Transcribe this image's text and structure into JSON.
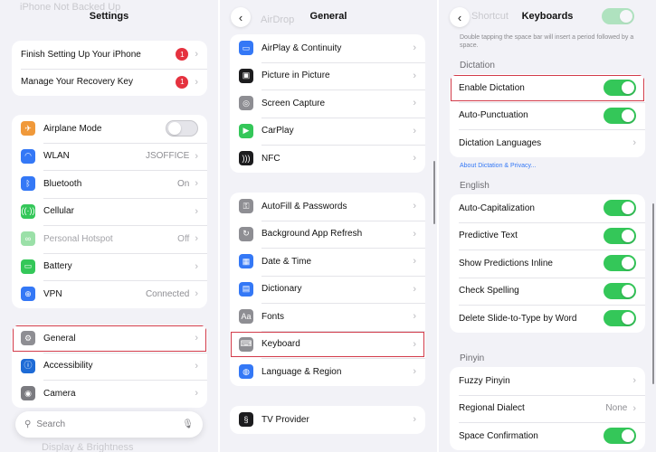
{
  "colors": {
    "accent": "#3478f6",
    "toggle_on": "#34c759",
    "badge": "#e5323f",
    "highlight": "#d23b4a"
  },
  "settings": {
    "title": "Settings",
    "ghost_top": "iPhone Not Backed Up",
    "account": [
      {
        "label": "Finish Setting Up Your iPhone",
        "badge": "1"
      },
      {
        "label": "Manage Your Recovery Key",
        "badge": "1"
      }
    ],
    "network": [
      {
        "label": "Airplane Mode",
        "icon": "airplane-icon",
        "color": "#f0993a",
        "toggle": "off"
      },
      {
        "label": "WLAN",
        "value": "JSOFFICE",
        "icon": "wifi-icon",
        "color": "#3478f6"
      },
      {
        "label": "Bluetooth",
        "value": "On",
        "icon": "bluetooth-icon",
        "color": "#3478f6"
      },
      {
        "label": "Cellular",
        "icon": "cellular-icon",
        "color": "#34c759"
      },
      {
        "label": "Personal Hotspot",
        "value": "Off",
        "icon": "hotspot-icon",
        "color": "#9be0a8",
        "dim": true
      },
      {
        "label": "Battery",
        "icon": "battery-icon",
        "color": "#34c759"
      },
      {
        "label": "VPN",
        "value": "Connected",
        "icon": "vpn-icon",
        "color": "#3478f6"
      }
    ],
    "general": [
      {
        "label": "General",
        "icon": "gear-icon",
        "color": "#8e8e93"
      },
      {
        "label": "Accessibility",
        "icon": "accessibility-icon",
        "color": "#1e6bd6"
      },
      {
        "label": "Camera",
        "icon": "camera-icon",
        "color": "#7b7b80"
      }
    ],
    "ghost_bottom": "Display & Brightness",
    "search_placeholder": "Search"
  },
  "general": {
    "title": "General",
    "ghost_top": "AirDrop",
    "group1": [
      {
        "label": "AirPlay & Continuity",
        "icon": "airplay-icon",
        "color": "#3478f6"
      },
      {
        "label": "Picture in Picture",
        "icon": "pip-icon",
        "color": "#1c1c1e"
      },
      {
        "label": "Screen Capture",
        "icon": "screen-capture-icon",
        "color": "#8e8e93"
      },
      {
        "label": "CarPlay",
        "icon": "carplay-icon",
        "color": "#34c759"
      },
      {
        "label": "NFC",
        "icon": "nfc-icon",
        "color": "#1c1c1e"
      }
    ],
    "group2": [
      {
        "label": "AutoFill & Passwords",
        "icon": "key-icon",
        "color": "#8e8e93"
      },
      {
        "label": "Background App Refresh",
        "icon": "refresh-icon",
        "color": "#8e8e93"
      },
      {
        "label": "Date & Time",
        "icon": "calendar-icon",
        "color": "#3478f6"
      },
      {
        "label": "Dictionary",
        "icon": "dictionary-icon",
        "color": "#3478f6"
      },
      {
        "label": "Fonts",
        "icon": "fonts-icon",
        "color": "#8e8e93"
      },
      {
        "label": "Keyboard",
        "icon": "keyboard-icon",
        "color": "#8e8e93"
      },
      {
        "label": "Language & Region",
        "icon": "globe-icon",
        "color": "#3478f6"
      }
    ],
    "group3": [
      {
        "label": "TV Provider",
        "icon": "tv-provider-icon",
        "color": "#1c1c1e"
      }
    ]
  },
  "keyboards": {
    "title": "Keyboards",
    "ghost_top": "Shortcut",
    "shortcut_note": "Double tapping the space bar will insert a period followed by a space.",
    "dictation_header": "Dictation",
    "dictation": [
      {
        "label": "Enable Dictation",
        "toggle": "on"
      },
      {
        "label": "Auto-Punctuation",
        "toggle": "on"
      },
      {
        "label": "Dictation Languages"
      }
    ],
    "about_link": "About Dictation & Privacy...",
    "english_header": "English",
    "english": [
      {
        "label": "Auto-Capitalization",
        "toggle": "on"
      },
      {
        "label": "Predictive Text",
        "toggle": "on"
      },
      {
        "label": "Show Predictions Inline",
        "toggle": "on"
      },
      {
        "label": "Check Spelling",
        "toggle": "on"
      },
      {
        "label": "Delete Slide-to-Type by Word",
        "toggle": "on"
      }
    ],
    "pinyin_header": "Pinyin",
    "pinyin": [
      {
        "label": "Fuzzy Pinyin"
      },
      {
        "label": "Regional Dialect",
        "value": "None"
      },
      {
        "label": "Space Confirmation",
        "toggle": "on"
      }
    ]
  }
}
